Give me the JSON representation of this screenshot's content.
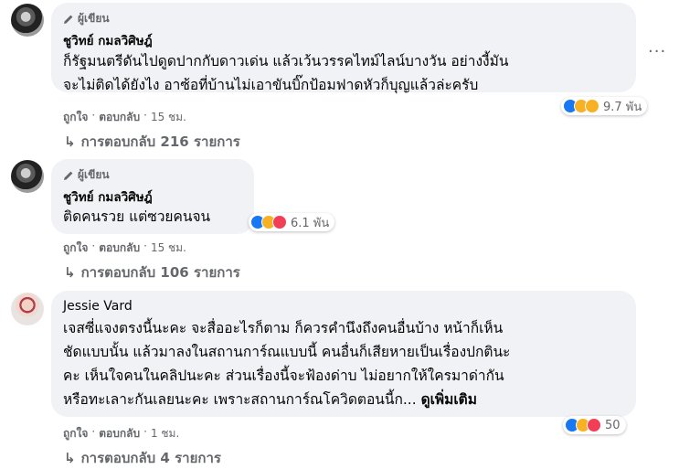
{
  "comments": [
    {
      "badge": "ผู้เขียน",
      "name": "ชูวิทย์ กมลวิศิษฎ์",
      "lines": [
        "ก็รัฐมนตรีดันไปดูดปากกับดาวเด่น แล้วเว้นวรรคไทม์ไลน์บางวัน อย่างงี้มัน",
        "จะไม่ติดได้ยังไง อาซ้อที่บ้านไม่เอาขันบิ๊กป้อมฟาดหัวก็บุญแล้วล่ะครับ"
      ],
      "like": "ถูกใจ",
      "reply": "ตอบกลับ",
      "time": "15 ชม.",
      "reaction_count": "9.7 พัน",
      "replies": "การตอบกลับ 216 รายการ"
    },
    {
      "badge": "ผู้เขียน",
      "name": "ชูวิทย์ กมลวิศิษฎ์",
      "lines": [
        "ติดคนรวย แต่ซวยคนจน"
      ],
      "like": "ถูกใจ",
      "reply": "ตอบกลับ",
      "time": "15 ชม.",
      "reaction_count": "6.1 พัน",
      "replies": "การตอบกลับ 106 รายการ"
    },
    {
      "name": "Jessie Vard",
      "lines": [
        "เจสซี่แจงตรงนี้นะคะ จะสื่ออะไรก็ตาม ก็ควรคำนึงถึงคนอื่นบ้าง หน้าก็เห็น",
        "ชัดแบบนั้น แล้วมาลงในสถานการ์ณแบบนี้ คนอื่นก็เสียหายเป็นเรื่องปกตินะ",
        "คะ เห็นใจคนในคลิปนะคะ ส่วนเรื่องนี้จะฟ้องด่าบ ไม่อยากให้ใครมาด่ากัน",
        "หรือทะเลาะกันเลยนะคะ เพราะสถานการ์ณโควิดตอนนี้ก..."
      ],
      "see_more": "ดูเพิ่มเติม",
      "like": "ถูกใจ",
      "reply": "ตอบกลับ",
      "time": "1 ชม.",
      "reaction_count": "50",
      "replies": "การตอบกลับ 4 รายการ"
    }
  ],
  "more_options": "···",
  "colors": {
    "bubble": "#f0f2f5",
    "secondary_text": "#65676b",
    "like_blue": "#1877f2",
    "haha_yellow": "#f7b125",
    "love_red": "#f33e58"
  }
}
